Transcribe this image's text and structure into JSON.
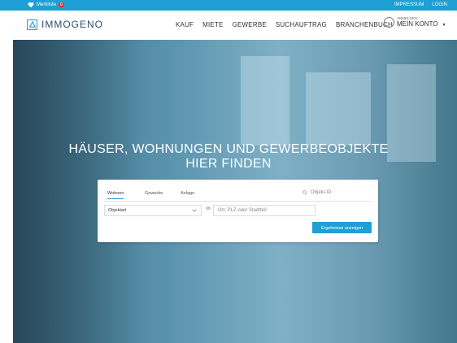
{
  "topbar": {
    "merkliste_label": "Merkliste",
    "merkliste_count": "0",
    "impressum_label": "IMPRESSUM",
    "login_label": "LOGIN"
  },
  "header": {
    "logo_text": "IMMOGENO",
    "nav": [
      "KAUF",
      "MIETE",
      "GEWERBE",
      "SUCHAUFTRAG",
      "BRANCHENBUCH"
    ],
    "account_small": "ANMELDEN",
    "account_big": "MEIN KONTO"
  },
  "hero": {
    "headline_line1": "HÄUSER, WOHNUNGEN UND GEWERBEOBJEKTE",
    "headline_line2": "HIER FINDEN"
  },
  "search": {
    "tabs": [
      "Wohnen",
      "Gewerbe",
      "Anlage"
    ],
    "active_tab": "Wohnen",
    "objekt_id_placeholder": "Objekt-ID",
    "property_type_value": "Objektart",
    "in_label": "in",
    "location_placeholder": "Ort, PLZ oder Stadtteil",
    "submit_label": "Ergebnisse anzeigen"
  },
  "colors": {
    "accent": "#1e9fd6",
    "topbar": "#1e9fd6",
    "logo_text": "#2c4f73",
    "badge": "#e53935"
  },
  "icons": [
    "heart-icon",
    "logo-icon",
    "user-circle-icon",
    "chevron-down-icon",
    "search-icon"
  ]
}
